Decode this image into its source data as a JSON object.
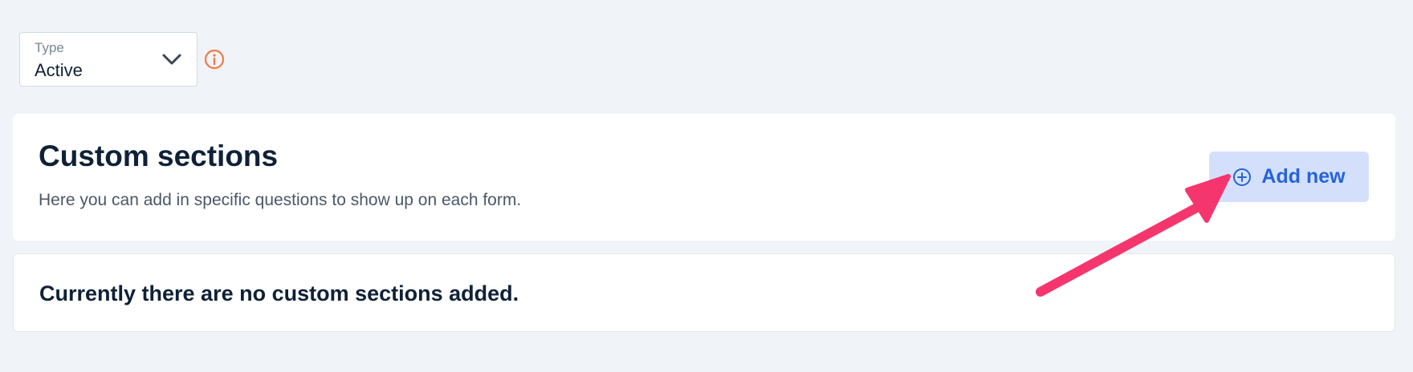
{
  "filter": {
    "label": "Type",
    "value": "Active",
    "icon": "chevron-down-icon",
    "info_icon": "info-icon",
    "info_color": "#f07a45"
  },
  "custom_sections": {
    "title": "Custom sections",
    "description": "Here you can add in specific questions to show up on each form.",
    "add_button": {
      "label": "Add new",
      "icon": "plus-circle-icon",
      "color": "#2563d9",
      "background": "#d4e0fb"
    },
    "empty_message": "Currently there are no custom sections added."
  },
  "annotation": {
    "icon": "arrow-icon",
    "color": "#f5366e"
  }
}
